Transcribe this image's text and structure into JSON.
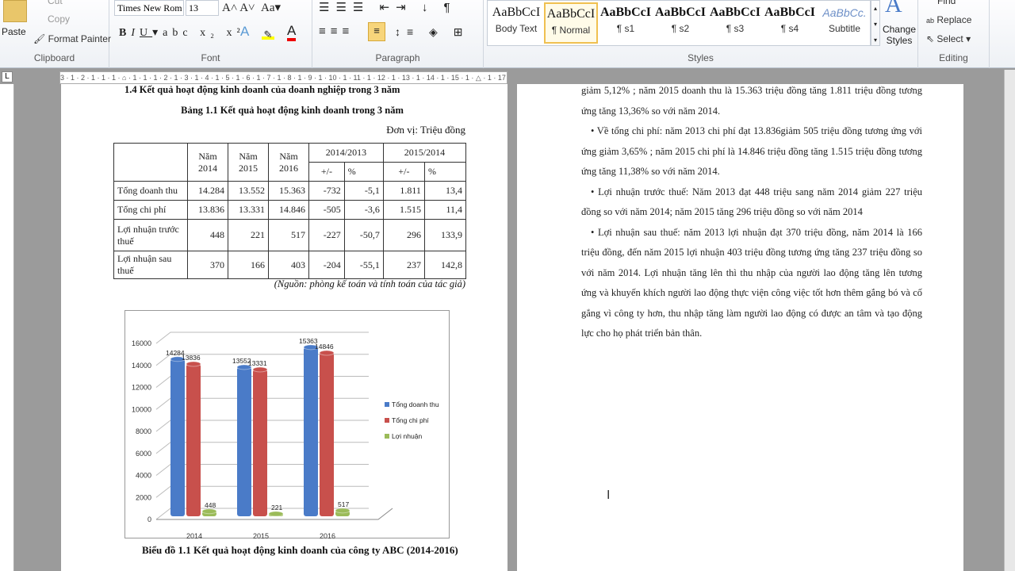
{
  "ribbon": {
    "clipboard": {
      "label": "Clipboard",
      "paste": "Paste",
      "cut": "Cut",
      "copy": "Copy",
      "format_painter": "Format Painter"
    },
    "font": {
      "label": "Font",
      "family": "Times New Rom",
      "size": "13"
    },
    "paragraph": {
      "label": "Paragraph"
    },
    "styles": {
      "label": "Styles",
      "items": [
        {
          "preview": "AaBbCcI",
          "name": "Body Text"
        },
        {
          "preview": "AaBbCcI",
          "name": "¶ Normal"
        },
        {
          "preview": "AaBbCcI",
          "name": "¶ s1"
        },
        {
          "preview": "AaBbCcI",
          "name": "¶ s2"
        },
        {
          "preview": "AaBbCcI",
          "name": "¶ s3"
        },
        {
          "preview": "AaBbCcI",
          "name": "¶ s4"
        },
        {
          "preview": "AaBbCc.",
          "name": "Subtitle"
        }
      ],
      "change_styles": "Change Styles"
    },
    "editing": {
      "label": "Editing",
      "find": "Find",
      "replace": "Replace",
      "select": "Select"
    }
  },
  "ruler": {
    "marks": "3 · 1 · 2 · 1 · 1 · 1 · ⌂ · 1 · 1 · 1 · 2 · 1 · 3 · 1 · 4 · 1 · 5 · 1 · 6 · 1 · 7 · 1 · 8 · 1 · 9 · 1 · 10 · 1 · 11 · 1 · 12 · 1 · 13 · 1 · 14 · 1 · 15 · 1 · △ · 1 · 17 · 1"
  },
  "page1": {
    "heading": "1.4 Kết quả hoạt động kinh doanh của doanh nghiệp trong 3 năm",
    "table_title": "Bảng 1.1 Kết quả hoạt động kinh doanh trong 3 năm",
    "unit": "Đơn vị: Triệu đồng",
    "table": {
      "headers": [
        "Năm 2014",
        "Năm 2015",
        "Năm 2016",
        "2014/2013",
        "2015/2014"
      ],
      "sub": [
        "+/-",
        "%",
        "+/-",
        "%"
      ],
      "rows": [
        [
          "Tổng doanh thu",
          "14.284",
          "13.552",
          "15.363",
          "-732",
          "-5,1",
          "1.811",
          "13,4"
        ],
        [
          "Tổng chi phí",
          "13.836",
          "13.331",
          "14.846",
          "-505",
          "-3,6",
          "1.515",
          "11,4"
        ],
        [
          "Lợi nhuận trước thuế",
          "448",
          "221",
          "517",
          "-227",
          "-50,7",
          "296",
          "133,9"
        ],
        [
          "Lợi nhuận sau thuế",
          "370",
          "166",
          "403",
          "-204",
          "-55,1",
          "237",
          "142,8"
        ]
      ]
    },
    "source": "(Nguồn: phòng kế toán và tính toán của tác giả)",
    "chart_caption": "Biểu đồ 1.1 Kết quả hoạt động kinh doanh của công ty ABC (2014-2016)"
  },
  "chart_data": {
    "type": "bar",
    "categories": [
      "2014",
      "2015",
      "2016"
    ],
    "series": [
      {
        "name": "Tổng doanh thu",
        "values": [
          14284,
          13552,
          15363
        ],
        "color": "#4a7bc8"
      },
      {
        "name": "Tổng chi phí",
        "values": [
          13836,
          13331,
          14846
        ],
        "color": "#c8504c"
      },
      {
        "name": "Lợi nhuận",
        "values": [
          448,
          221,
          517
        ],
        "color": "#9bbb59"
      }
    ],
    "ylim": [
      0,
      16000
    ],
    "yticks": [
      "0",
      "2000",
      "4000",
      "6000",
      "8000",
      "10000",
      "12000",
      "14000",
      "16000"
    ],
    "grid": true,
    "legend": "right",
    "style": "3d-cylinder"
  },
  "page2": {
    "paragraphs": [
      "giảm 5,12% ; năm 2015 doanh thu là 15.363 triệu đồng tăng 1.811 triệu đồng tương ứng tăng 13,36% so với năm 2014.",
      "•  Về tổng chi phí: năm 2013 chi phí đạt 13.836giảm 505 triệu đồng tương ứng với ứng giảm 3,65% ; năm 2015 chi phí là 14.846 triệu đồng tăng 1.515 triệu đồng tương ứng tăng 11,38% so với năm 2014.",
      "•  Lợi nhuận trước thuế: Năm 2013 đạt 448 triệu sang năm 2014 giảm 227 triệu đồng so với năm 2014; năm 2015 tăng 296 triệu đồng so với năm 2014",
      "•  Lợi nhuận sau thuế: năm 2013 lợi nhuận đạt 370 triệu đồng, năm 2014 là 166 triệu đồng, đến năm 2015 lợi nhuận 403 triệu đồng tương ứng tăng 237 triệu đồng  so với năm 2014. Lợi nhuận tăng lên thì thu nhập của người lao động tăng lên tương ứng và khuyến khích người lao động thực viện công việc tốt hơn thêm gắng bó và cố gắng vì công ty hơn, thu nhập tăng làm người lao động có được an tâm và tạo động lực cho họ phát triển bản thân."
    ]
  }
}
